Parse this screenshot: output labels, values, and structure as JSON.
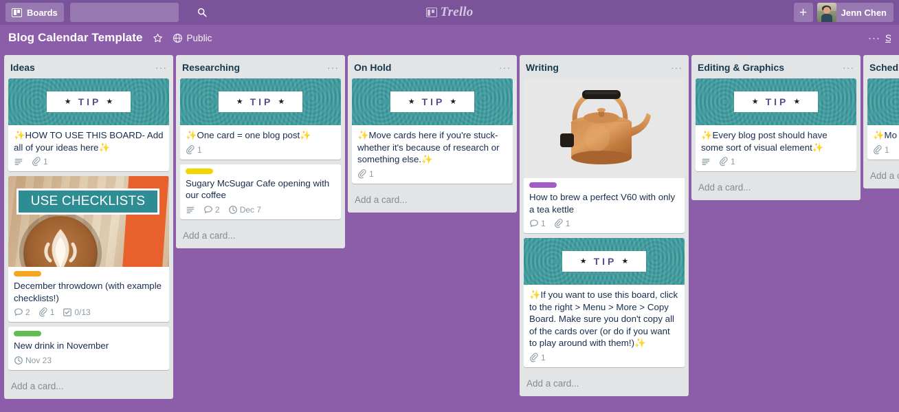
{
  "top_nav": {
    "boards_label": "Boards",
    "boards_icon": "board-icon",
    "search_placeholder": "",
    "search_value": "",
    "search_icon": "search-icon",
    "logo_text": "Trello",
    "logo_icon": "board-icon",
    "plus_label": "+",
    "member_name": "Jenn Chen",
    "avatar_icon": "user-avatar"
  },
  "board_header": {
    "title": "Blog Calendar Template",
    "star_icon": "star-outline-icon",
    "visibility_icon": "globe-icon",
    "visibility_label": "Public",
    "dots_label": "···",
    "menu_label": "Show Menu"
  },
  "colors": {
    "top_nav_bg": "#7B539A",
    "board_bg": "#8C5DA8",
    "list_bg": "#E2E4E6",
    "card_bg": "#FFFFFF",
    "tip_cover": "#3A9A9D",
    "tip_word": "#5B4B8A",
    "label_orange": "#F5A623",
    "label_green": "#61BD4F",
    "label_yellow": "#F2D600",
    "label_purple": "#A35BC7",
    "text_primary": "#172B4D",
    "text_muted": "#8C9AA3",
    "banner_teal": "#2E8D92",
    "photo_orange": "#E8602C"
  },
  "add_card_label": "Add a card...",
  "lists": [
    {
      "name": "Ideas",
      "dots": "···",
      "cards": [
        {
          "cover": "tip",
          "title": "✨HOW TO USE THIS BOARD- Add all of your ideas here✨",
          "badges": [
            {
              "icon": "description-icon",
              "value": ""
            },
            {
              "icon": "attachment-icon",
              "value": "1"
            }
          ]
        },
        {
          "cover": "checklist-photo",
          "cover_text": "USE CHECKLISTS",
          "label": "label_orange",
          "title": "December throwdown (with example checklists!)",
          "badges": [
            {
              "icon": "comment-icon",
              "value": "2"
            },
            {
              "icon": "attachment-icon",
              "value": "1"
            },
            {
              "icon": "checklist-icon",
              "value": "0/13"
            }
          ]
        },
        {
          "cover": "none",
          "label": "label_green",
          "title": "New drink in November",
          "badges": [
            {
              "icon": "clock-icon",
              "value": "Nov 23"
            }
          ]
        }
      ]
    },
    {
      "name": "Researching",
      "dots": "···",
      "cards": [
        {
          "cover": "tip",
          "title": "✨One card = one blog post✨",
          "badges": [
            {
              "icon": "attachment-icon",
              "value": "1"
            }
          ]
        },
        {
          "cover": "none",
          "label": "label_yellow",
          "title": "Sugary McSugar Cafe opening with our coffee",
          "badges": [
            {
              "icon": "description-icon",
              "value": ""
            },
            {
              "icon": "comment-icon",
              "value": "2"
            },
            {
              "icon": "clock-icon",
              "value": "Dec 7"
            }
          ]
        }
      ]
    },
    {
      "name": "On Hold",
      "dots": "···",
      "cards": [
        {
          "cover": "tip",
          "title": "✨Move cards here if you're stuck- whether it's because of research or something else.✨",
          "badges": [
            {
              "icon": "attachment-icon",
              "value": "1"
            }
          ]
        }
      ]
    },
    {
      "name": "Writing",
      "dots": "···",
      "cards": [
        {
          "cover": "kettle-photo",
          "label": "label_purple",
          "title": "How to brew a perfect V60 with only a tea kettle",
          "badges": [
            {
              "icon": "comment-icon",
              "value": "1"
            },
            {
              "icon": "attachment-icon",
              "value": "1"
            }
          ]
        },
        {
          "cover": "tip",
          "title": "✨If you want to use this board, click to the right > Menu > More > Copy Board. Make sure you don't copy all of the cards over (or do if you want to play around with them!)✨",
          "badges": [
            {
              "icon": "attachment-icon",
              "value": "1"
            }
          ]
        }
      ]
    },
    {
      "name": "Editing & Graphics",
      "dots": "···",
      "cards": [
        {
          "cover": "tip",
          "title": "✨Every blog post should have some sort of visual element✨",
          "badges": [
            {
              "icon": "description-icon",
              "value": ""
            },
            {
              "icon": "attachment-icon",
              "value": "1"
            }
          ]
        }
      ]
    },
    {
      "name": "Sched",
      "dots": "···",
      "cards": [
        {
          "cover": "tip",
          "title": "✨Mo\n✨",
          "badges": [
            {
              "icon": "attachment-icon",
              "value": "1"
            }
          ]
        }
      ]
    }
  ],
  "tip_cover": {
    "left_star": "★",
    "word": "TIP",
    "right_star": "★"
  }
}
